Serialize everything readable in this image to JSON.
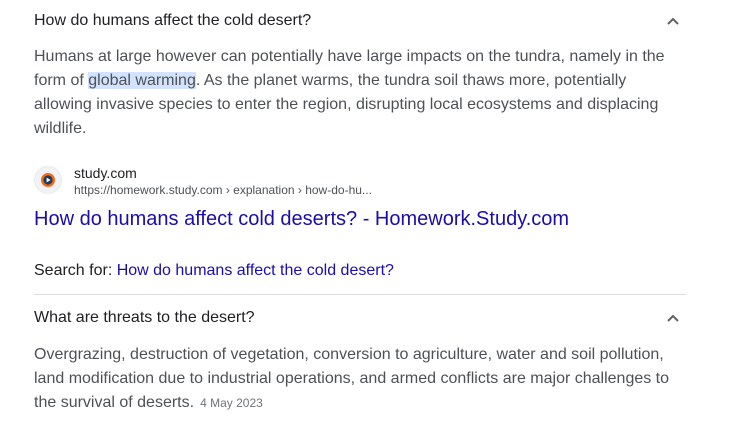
{
  "faq": [
    {
      "question": "How do humans affect the cold desert?",
      "answer_before": "Humans at large however can potentially have large impacts on the tundra, namely in the form of ",
      "answer_highlight": "global warming",
      "answer_after": ". As the planet warms, the tundra soil thaws more, potentially allowing invasive species to enter the region, disrupting local ecosystems and displacing wildlife."
    },
    {
      "question": "What are threats to the desert?",
      "answer": "Overgrazing, destruction of vegetation, conversion to agriculture, water and soil pollution, land modification due to industrial operations, and armed conflicts are major challenges to the survival of deserts.",
      "date": "4 May 2023"
    }
  ],
  "source": {
    "name": "study.com",
    "url": "https://homework.study.com › explanation › how-do-hu...",
    "icon": "study-com-favicon"
  },
  "result": {
    "title": "How do humans affect cold deserts? - Homework.Study.com"
  },
  "search_for": {
    "label": "Search for: ",
    "query": "How do humans affect the cold desert?"
  },
  "colors": {
    "link": "#1a0dab",
    "highlight": "#d3e3fd",
    "divider": "#dadce0"
  }
}
